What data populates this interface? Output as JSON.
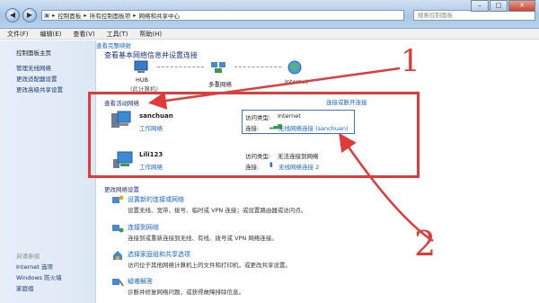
{
  "window": {
    "breadcrumb": [
      "控制面板",
      "所有控制面板项",
      "网络和共享中心"
    ],
    "search_placeholder": "搜索控制面板",
    "controls": [
      "–",
      "□",
      "✕"
    ]
  },
  "menu": [
    "文件(F)",
    "编辑(E)",
    "查看(V)",
    "工具(T)",
    "帮助(H)"
  ],
  "sidebar": {
    "top_links": [
      "控制面板主页",
      "管理无线网络",
      "更改适配器设置",
      "更改高级共享设置"
    ],
    "see_also_title": "另请参阅",
    "see_also_links": [
      "Internet 选项",
      "Windows 防火墙",
      "家庭组"
    ]
  },
  "main": {
    "title": "查看基本网络信息并设置连接",
    "full_map_link": "查看完整映射",
    "map_nodes": [
      "HUB",
      "多重网络",
      "Internet"
    ],
    "map_node_sub": "(此计算机)",
    "active_networks_label": "查看活动网络",
    "connect_link": "连接或断开连接",
    "networks": [
      {
        "name": "sanchuan",
        "type": "工作网络",
        "access_label": "访问类型:",
        "access": "Internet",
        "conn_label": "连接:",
        "conn": "无线网络连接 (sanchuan)"
      },
      {
        "name": "Lili123",
        "type": "工作网络",
        "access_label": "访问类型:",
        "access": "无法连接到网络",
        "conn_label": "连接:",
        "conn": "无线网络连接 2"
      }
    ],
    "change_settings_label": "更改网络设置",
    "tasks": [
      {
        "title": "设置新的连接或网络",
        "desc": "设置无线、宽带、拨号、临时或 VPN 连接；或设置路由器或访问点。"
      },
      {
        "title": "连接到网络",
        "desc": "连接到或重新连接到无线、有线、拨号或 VPN 网络连接。"
      },
      {
        "title": "选择家庭组和共享选项",
        "desc": "访问位于其他网络计算机上的文件和打印机，或更改共享设置。"
      },
      {
        "title": "疑难解答",
        "desc": "诊断并修复网络问题，或获得故障排除信息。"
      }
    ]
  },
  "annotations": [
    "1",
    "2"
  ],
  "colors": {
    "annotation_red": "#e03a3a",
    "link_blue": "#1766c6",
    "heading_blue": "#1e3287"
  }
}
